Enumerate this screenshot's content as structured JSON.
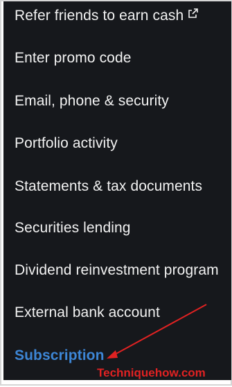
{
  "menu": {
    "items": [
      {
        "label": "Refer friends to earn cash",
        "icon": "external-link-icon"
      },
      {
        "label": "Enter promo code"
      },
      {
        "label": "Email, phone & security"
      },
      {
        "label": "Portfolio activity"
      },
      {
        "label": "Statements & tax documents"
      },
      {
        "label": "Securities lending"
      },
      {
        "label": "Dividend reinvestment program"
      },
      {
        "label": "External bank account"
      },
      {
        "label": "Subscription",
        "highlighted": true
      }
    ]
  },
  "annotation": {
    "watermark": "Techniquehow.com",
    "arrow_color": "#e12222"
  },
  "colors": {
    "panel_background": "#16181c",
    "text": "#f2f2f2",
    "accent": "#3d86d6",
    "watermark": "#e12222"
  }
}
